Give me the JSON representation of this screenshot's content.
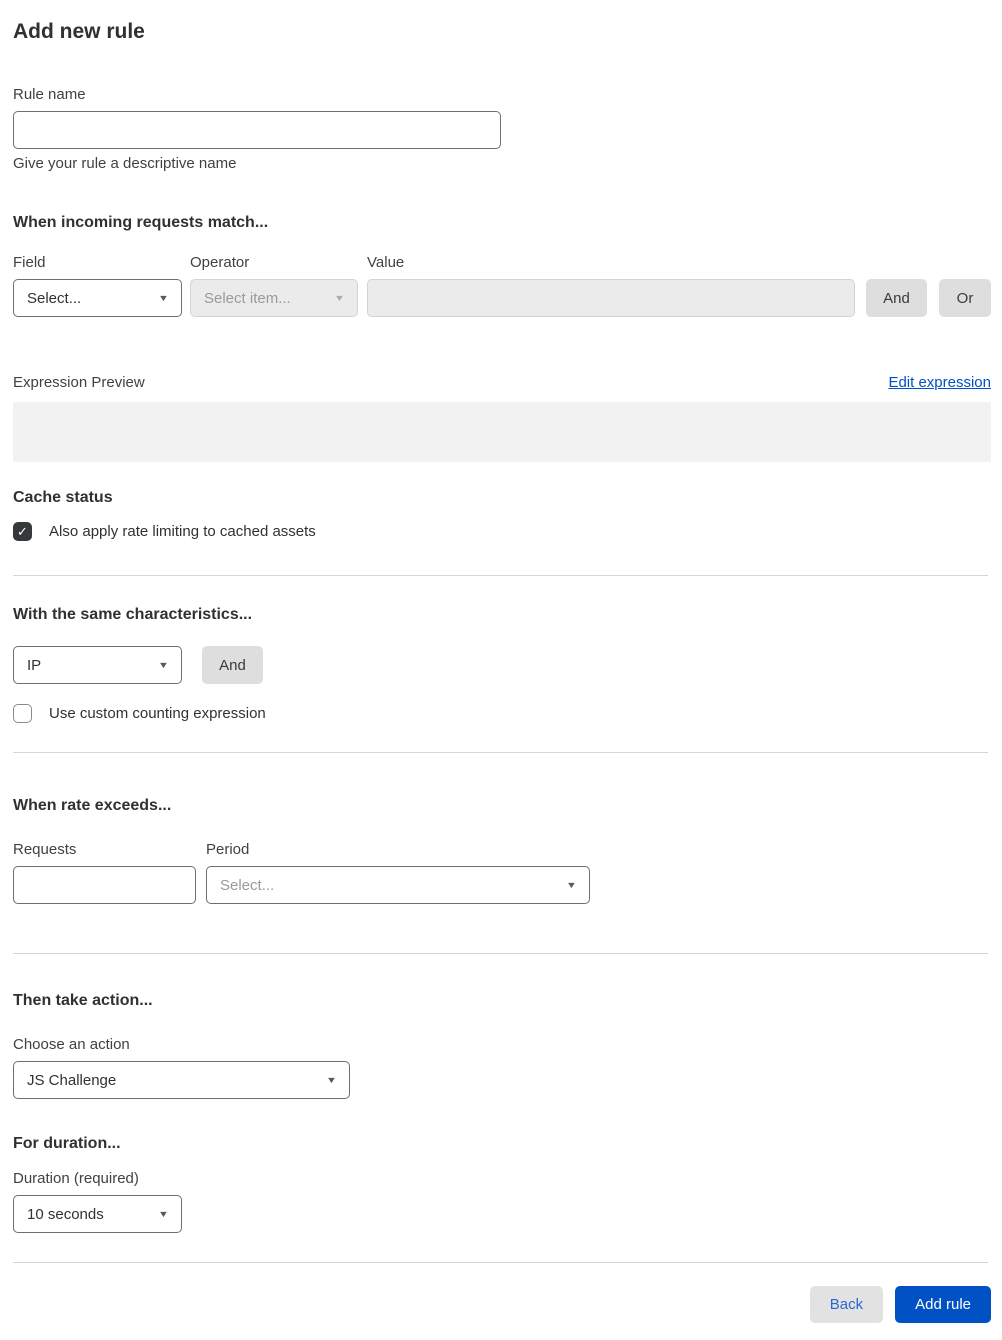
{
  "page": {
    "title": "Add new rule"
  },
  "rule_name": {
    "label": "Rule name",
    "value": "",
    "helper": "Give your rule a descriptive name"
  },
  "match": {
    "heading": "When incoming requests match...",
    "field": {
      "label": "Field",
      "value": "Select..."
    },
    "operator": {
      "label": "Operator",
      "value": "Select item..."
    },
    "value_input": {
      "label": "Value",
      "value": ""
    },
    "and_label": "And",
    "or_label": "Or"
  },
  "expression": {
    "preview_label": "Expression Preview",
    "edit_link": "Edit expression",
    "preview_value": ""
  },
  "cache_status": {
    "heading": "Cache status",
    "checkbox_label": "Also apply rate limiting to cached assets",
    "checked": true,
    "checkmark": "✓"
  },
  "characteristics": {
    "heading": "With the same characteristics...",
    "select_value": "IP",
    "and_label": "And",
    "checkbox_label": "Use custom counting expression",
    "checked": false
  },
  "rate": {
    "heading": "When rate exceeds...",
    "requests": {
      "label": "Requests",
      "value": ""
    },
    "period": {
      "label": "Period",
      "value": "Select..."
    }
  },
  "action": {
    "heading": "Then take action...",
    "label": "Choose an action",
    "value": "JS Challenge"
  },
  "duration": {
    "heading": "For duration...",
    "label": "Duration (required)",
    "value": "10 seconds"
  },
  "footer": {
    "back_label": "Back",
    "submit_label": "Add rule"
  },
  "icons": {
    "caret": "▼"
  },
  "colors": {
    "accent": "#0051c3",
    "checkbox-dark": "#36393a",
    "disabled-bg": "#ebebeb",
    "preview-bg": "#f2f2f2"
  }
}
